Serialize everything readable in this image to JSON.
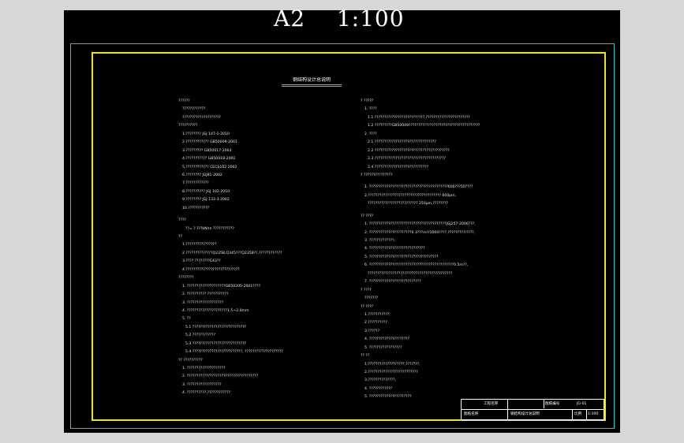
{
  "drawing": {
    "sheet_size": "A2",
    "scale": "1:100",
    "heading": "钢结构设计总说明"
  },
  "left_column": [
    {
      "text": "??????",
      "indent": 0
    },
    {
      "text": "????????????",
      "indent": 1
    },
    {
      "text": "????????????????????",
      "indent": 1
    },
    {
      "text": "??????????",
      "indent": 0
    },
    {
      "text": "1.????????    JGJ 147-1-2010",
      "indent": 1
    },
    {
      "text": "2.????????????    GB50009-2001",
      "indent": 1
    },
    {
      "text": "3.?????????    GB50017-2003",
      "indent": 1
    },
    {
      "text": "4.???????????    GB50018-2002",
      "indent": 1
    },
    {
      "text": "5.????????????    CECS102:2002",
      "indent": 1
    },
    {
      "text": "6.????????    JGJ81-2002",
      "indent": 1
    },
    {
      "text": "7.????????????",
      "indent": 1
    },
    {
      "text": "8.??????????    JGJ 102-2010",
      "indent": 1
    },
    {
      "text": "9.????????    JGJ 133-3-2002",
      "indent": 1
    },
    {
      "text": "10.???????????",
      "indent": 1
    },
    {
      "gap": true
    },
    {
      "text": "????",
      "indent": 0
    },
    {
      "text": "??= ?.???kN/m    ???????????",
      "indent": 2
    },
    {
      "text": "??",
      "indent": 0
    },
    {
      "text": "1.????????????????",
      "indent": 1
    },
    {
      "text": "2.??????????????Q235B,Q345???Q235B??,????????????",
      "indent": 1
    },
    {
      "text": "3.????    ????????E43??",
      "indent": 1
    },
    {
      "text": "4.????????????????????????????",
      "indent": 1
    },
    {
      "text": "????????",
      "indent": 0
    },
    {
      "text": "1.    ????????????????????GB50205-2001????",
      "indent": 1
    },
    {
      "text": "2.    ??????????    ???????????",
      "indent": 1
    },
    {
      "text": "3.    ???????????????????",
      "indent": 1
    },
    {
      "text": "4.    ?????????????????????1.5~2.0mm",
      "indent": 1
    },
    {
      "text": "5.    ??",
      "indent": 1
    },
    {
      "text": "5.1    ????????????????????????????",
      "indent": 2
    },
    {
      "text": "5.2    ????????????",
      "indent": 2
    },
    {
      "text": "5.3    ????????????????????????????",
      "indent": 2
    },
    {
      "text": "5.4    ??????????????????????????,    ????????????????????",
      "indent": 2
    },
    {
      "text": "??    ??????????",
      "indent": 0
    },
    {
      "text": "1.    ????????????????????",
      "indent": 1
    },
    {
      "text": "2.    ?????????????????????????????????????",
      "indent": 1
    },
    {
      "text": "3.    ??????????????????",
      "indent": 1
    },
    {
      "text": "4.    ??????????,????????????",
      "indent": 1
    }
  ],
  "right_column": [
    {
      "text": "?    ?????",
      "indent": 0
    },
    {
      "text": "1.    ????",
      "indent": 1
    },
    {
      "text": "1.1    ??????????????????????????,???????????????????????",
      "indent": 2
    },
    {
      "text": "1.2    ?????????GB50009?????????????????????????????????????",
      "indent": 2
    },
    {
      "text": "2.    ????",
      "indent": 1
    },
    {
      "text": "2.1    ????????????????????????????????",
      "indent": 2
    },
    {
      "text": "2.2    ???????????????????????????????????????",
      "indent": 2
    },
    {
      "text": "2.3    ?????????????????????????????????????",
      "indent": 2
    },
    {
      "text": "2.4    ????????????????????????????",
      "indent": 2
    },
    {
      "text": "?    ???????????????",
      "indent": 0
    },
    {
      "gap": true
    },
    {
      "text": "1.    ?????????????????????????????????????????600???50????",
      "indent": 1
    },
    {
      "text": "2.??????????????????????????????????????    600μm,",
      "indent": 1
    },
    {
      "text": "??????????????????????????    250μm,????????",
      "indent": 2
    },
    {
      "gap": true
    },
    {
      "text": "??    ????",
      "indent": 0
    },
    {
      "text": "1.    ????????????????????????????????????????JGJ257-2006???,",
      "indent": 1
    },
    {
      "text": "2.    ??????????????????????0.3???m?/1000????,?????????/????,",
      "indent": 1
    },
    {
      "text": "3.    ?????????????,",
      "indent": 1
    },
    {
      "text": "4.    ?????????????????????????????",
      "indent": 1
    },
    {
      "text": "5.    ????????????????????????????????????",
      "indent": 1
    },
    {
      "text": "6.    ????????????????????????????????????????????0.5m??,",
      "indent": 1
    },
    {
      "text": "????????????????????????????????????????????",
      "indent": 2
    },
    {
      "text": "7.    ???????????????????????????",
      "indent": 1
    },
    {
      "text": "?    ????",
      "indent": 0
    },
    {
      "text": "???????",
      "indent": 1
    },
    {
      "text": "??    ????",
      "indent": 0
    },
    {
      "text": "1.???????????,",
      "indent": 1
    },
    {
      "text": "2.??????????",
      "indent": 1
    },
    {
      "text": "3.??????",
      "indent": 1
    },
    {
      "text": "4.    ?????????????????????",
      "indent": 1
    },
    {
      "text": "5.    ?????????????????",
      "indent": 1
    },
    {
      "text": "??    ??",
      "indent": 0
    },
    {
      "text": "1.???????????????????,???????,",
      "indent": 1
    },
    {
      "text": "2.??????????????????????????",
      "indent": 1
    },
    {
      "text": "3.??????????????,",
      "indent": 1
    },
    {
      "text": "4.    ????????????",
      "indent": 1
    },
    {
      "text": "5.    ??????????????????????",
      "indent": 1
    }
  ],
  "title_block": {
    "project_label": "工程名称",
    "drawing_no_label": "图纸编号",
    "drawing_no_value": "JG-01",
    "drawing_name_label": "图纸名称",
    "drawing_name_value": "钢结构设计总说明",
    "scale_label": "比例",
    "scale_value": "1:100"
  }
}
